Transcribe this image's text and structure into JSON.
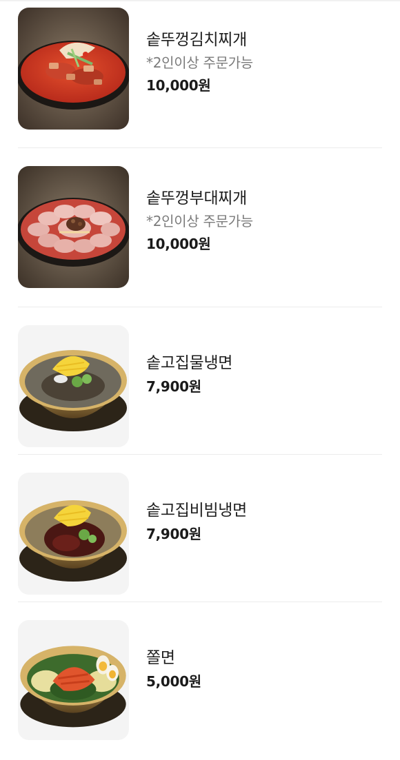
{
  "menu": {
    "items": [
      {
        "name": "솥뚜껑김치찌개",
        "note": "*2인이상 주문가능",
        "price": "10,000원",
        "image_icon": "kimchi-stew-photo"
      },
      {
        "name": "솥뚜껑부대찌개",
        "note": "*2인이상 주문가능",
        "price": "10,000원",
        "image_icon": "budae-stew-photo"
      },
      {
        "name": "솥고집물냉면",
        "price": "7,900원",
        "image_icon": "cold-noodle-photo"
      },
      {
        "name": "솥고집비빔냉면",
        "price": "7,900원",
        "image_icon": "spicy-cold-noodle-photo"
      },
      {
        "name": "쫄면",
        "price": "5,000원",
        "image_icon": "jjolmyeon-photo"
      }
    ]
  },
  "colors": {
    "text_primary": "#1e1e1e",
    "text_secondary": "#7b7b7b",
    "divider": "#ececec",
    "thumb_background": "#f4f4f4"
  }
}
